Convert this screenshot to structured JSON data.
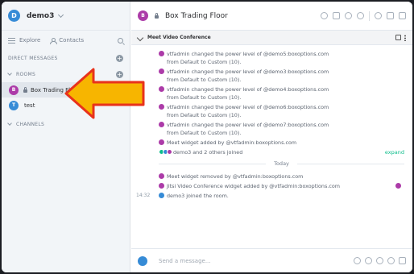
{
  "space": {
    "name": "demo3",
    "avatar_letter": "D"
  },
  "nav": {
    "explore": "Explore",
    "contacts": "Contacts"
  },
  "sections": {
    "direct_messages": "DIRECT MESSAGES",
    "rooms": "ROOMS",
    "channels": "CHANNELS"
  },
  "rooms": [
    {
      "name": "Box Trading Floor",
      "letter": "B",
      "color": "#ac3ba8",
      "active": true
    },
    {
      "name": "test",
      "letter": "T",
      "color": "#368bd6",
      "active": false
    }
  ],
  "room_header": {
    "title": "Box Trading Floor",
    "avatar_letter": "B"
  },
  "widget": {
    "title": "Meet Video Conference"
  },
  "events": [
    "vtfadmin changed the power level of @demo5:boxoptions.com from Default to Custom (10).",
    "vtfadmin changed the power level of @demo3:boxoptions.com from Default to Custom (10).",
    "vtfadmin changed the power level of @demo4:boxoptions.com from Default to Custom (10).",
    "vtfadmin changed the power level of @demo6:boxoptions.com from Default to Custom (10).",
    "vtfadmin changed the power level of @demo7:boxoptions.com from Default to Custom (10).",
    "Meet widget added by @vtfadmin:boxoptions.com"
  ],
  "joined_summary": "demo3 and 2 others joined",
  "expand_label": "expand",
  "day_divider": "Today",
  "today_events": [
    "Meet widget removed by @vtfadmin:boxoptions.com",
    "Jitsi Video Conference widget added by @vtfadmin:boxoptions.com",
    "demo3 joined the room."
  ],
  "timestamp": "14:32",
  "composer": {
    "placeholder": "Send a message..."
  },
  "colors": {
    "accent_green": "#0dbd8b",
    "purple": "#ac3ba8",
    "blue": "#368bd6",
    "arrow_yellow": "#f7b500",
    "arrow_red": "#e8321b"
  }
}
